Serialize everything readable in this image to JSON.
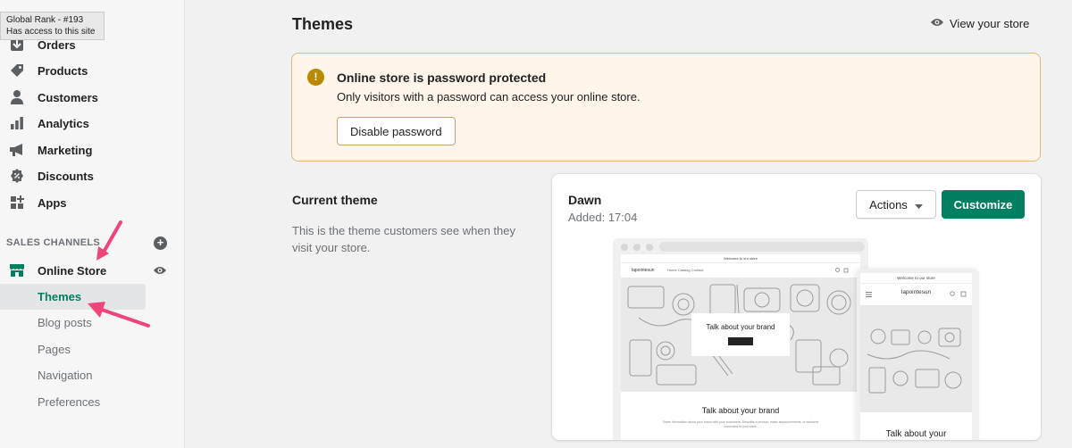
{
  "tooltip": {
    "line1": "Global Rank - #193",
    "line2": "Has access to this site"
  },
  "sidebar": {
    "items": [
      {
        "label": "Orders",
        "icon": "orders-icon"
      },
      {
        "label": "Products",
        "icon": "tag-icon"
      },
      {
        "label": "Customers",
        "icon": "person-icon"
      },
      {
        "label": "Analytics",
        "icon": "bar-chart-icon"
      },
      {
        "label": "Marketing",
        "icon": "megaphone-icon"
      },
      {
        "label": "Discounts",
        "icon": "discount-icon"
      },
      {
        "label": "Apps",
        "icon": "apps-icon"
      }
    ],
    "sales_channels_label": "SALES CHANNELS",
    "online_store_label": "Online Store",
    "sub_items": [
      "Themes",
      "Blog posts",
      "Pages",
      "Navigation",
      "Preferences"
    ],
    "active_sub_item": "Themes"
  },
  "header": {
    "title": "Themes",
    "view_store_label": "View your store"
  },
  "banner": {
    "icon_glyph": "!",
    "title": "Online store is password protected",
    "text": "Only visitors with a password can access your online store.",
    "button_label": "Disable password"
  },
  "current_theme": {
    "heading": "Current theme",
    "description": "This is the theme customers see when they visit your store.",
    "name": "Dawn",
    "added": "Added: 17:04",
    "actions_label": "Actions",
    "customize_label": "Customize"
  },
  "preview": {
    "announcement": "Welcome to our store",
    "store_name": "lapointesun",
    "nav_links": "Home   Catalog   Contact",
    "hero_text": "Talk about your brand",
    "section_title": "Talk about your brand",
    "section_text": "Share information about your brand with your customers. Describe a product, make announcements, or welcome customers to your store.",
    "mobile_title": "Talk about your"
  },
  "colors": {
    "accent": "#008060",
    "banner_bg": "#fff5ea",
    "banner_border": "#e1b878",
    "annotation_arrow": "#f0457a"
  }
}
